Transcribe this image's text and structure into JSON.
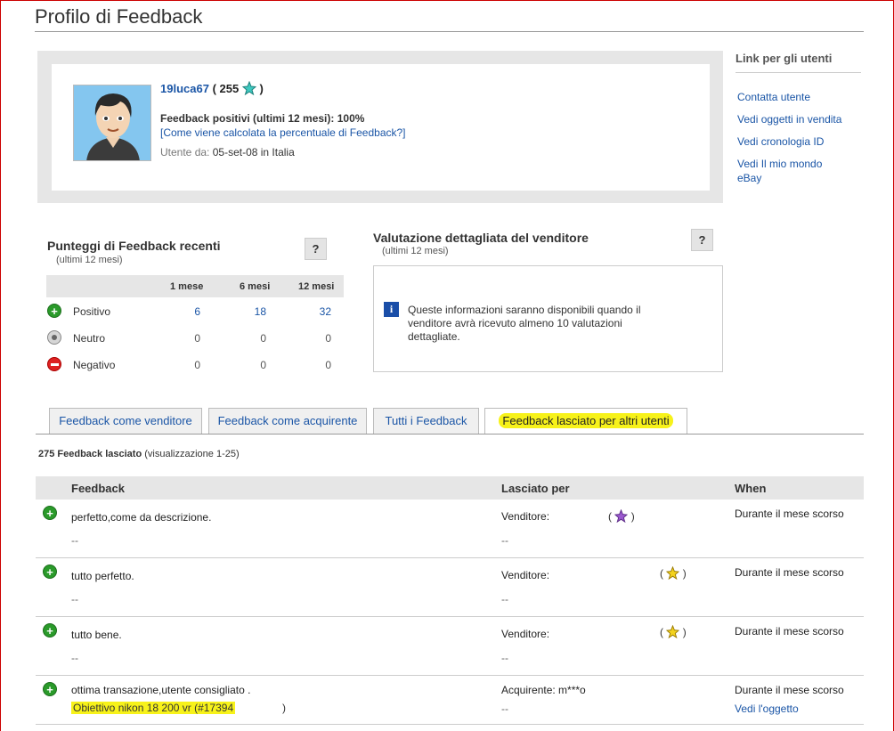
{
  "page": {
    "title": "Profilo di Feedback"
  },
  "profile": {
    "username": "19luca67",
    "score_open": "(",
    "score": "255",
    "score_close": ")",
    "positive_label": "Feedback positivi (ultimi 12 mesi): 100%",
    "calc_link": "[Come viene calcolata la percentuale di Feedback?]",
    "member_since_label": "Utente da:",
    "member_since_value": "05-set-08 in Italia"
  },
  "sidebar": {
    "title": "Link per gli utenti",
    "links": [
      "Contatta utente",
      "Vedi oggetti in vendita",
      "Vedi cronologia ID",
      "Vedi Il mio mondo eBay"
    ]
  },
  "recent": {
    "title": "Punteggi di Feedback recenti",
    "subtitle": "(ultimi 12 mesi)",
    "help": "?",
    "columns": [
      "1 mese",
      "6 mesi",
      "12 mesi"
    ],
    "rows": [
      {
        "label": "Positivo",
        "values": [
          "6",
          "18",
          "32"
        ]
      },
      {
        "label": "Neutro",
        "values": [
          "0",
          "0",
          "0"
        ]
      },
      {
        "label": "Negativo",
        "values": [
          "0",
          "0",
          "0"
        ]
      }
    ]
  },
  "dsr": {
    "title": "Valutazione dettagliata del venditore",
    "subtitle": "(ultimi 12 mesi)",
    "help": "?",
    "info_icon": "i",
    "info_text": "Queste informazioni saranno disponibili quando il venditore avrà ricevuto almeno 10 valutazioni dettagliate."
  },
  "tabs": [
    "Feedback come venditore",
    "Feedback come acquirente",
    "Tutti i Feedback",
    "Feedback lasciato per altri utenti"
  ],
  "count": {
    "bold": "275 Feedback lasciato",
    "rest": "(visualizzazione 1-25)"
  },
  "table": {
    "headers": [
      "Feedback",
      "Lasciato per",
      "When"
    ],
    "rows": [
      {
        "text": "perfetto,come da descrizione.",
        "sub": "--",
        "who": "Venditore:",
        "who_sub": "--",
        "when": "Durante il mese scorso",
        "score_open": "(",
        "score_close": ")"
      },
      {
        "text": "tutto perfetto.",
        "sub": "--",
        "who": "Venditore:",
        "who_sub": "--",
        "when": "Durante il mese scorso",
        "score_open": "(",
        "score_close": ")"
      },
      {
        "text": "tutto bene.",
        "sub": "--",
        "who": "Venditore:",
        "who_sub": "--",
        "when": "Durante il mese scorso",
        "score_open": "(",
        "score_close": ")"
      },
      {
        "text": "ottima transazione,utente consigliato .",
        "sub": "Obiettivo nikon 18 200 vr (#17394",
        "sub_tail": ")",
        "who": "Acquirente: m***o",
        "who_sub": "--",
        "when": "Durante il mese scorso",
        "link": "Vedi l'oggetto"
      }
    ]
  },
  "colors": {
    "link": "#1a55a6",
    "highlight": "#f7f21a",
    "positive": "#2a9a2a",
    "negative": "#dd2222",
    "info": "#1a4ea8"
  },
  "icons": [
    "positive-icon",
    "neutral-icon",
    "negative-icon",
    "help-icon",
    "info-icon",
    "star-icon",
    "shooting-star-icon",
    "avatar"
  ]
}
